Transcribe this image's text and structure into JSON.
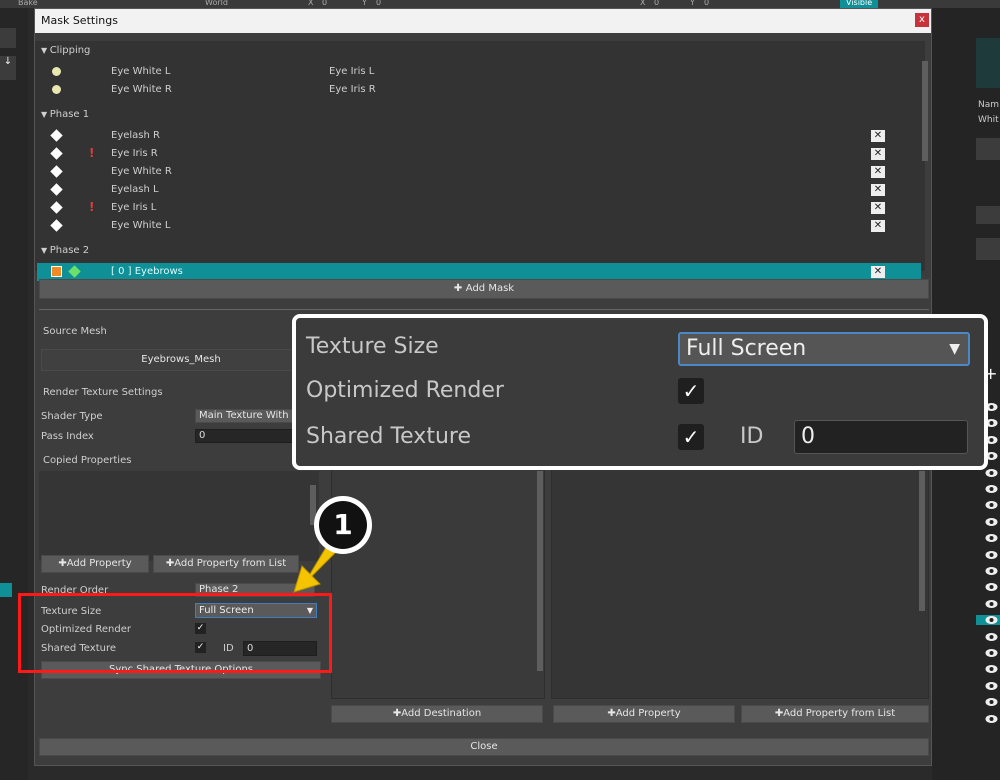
{
  "topbar": {
    "bake": "Bake",
    "world": "World",
    "x1": "X",
    "v1": "0",
    "y1": "Y",
    "v2": "0",
    "x2": "X",
    "v3": "0",
    "y2": "Y",
    "v4": "0",
    "visible": "Visible"
  },
  "right_panel": {
    "name_label": "Nam",
    "name_value": "Whit"
  },
  "dialog": {
    "title": "Mask Settings",
    "close_x": "x",
    "groups": [
      {
        "label": "Clipping",
        "rows": [
          {
            "name": "Eye White L",
            "name2": "Eye Iris L"
          },
          {
            "name": "Eye White R",
            "name2": "Eye Iris R"
          }
        ]
      },
      {
        "label": "Phase 1",
        "rows": [
          {
            "name": "Eyelash R",
            "warn": false
          },
          {
            "name": "Eye Iris R",
            "warn": true
          },
          {
            "name": "Eye White R",
            "warn": false
          },
          {
            "name": "Eyelash L",
            "warn": false
          },
          {
            "name": "Eye Iris L",
            "warn": true
          },
          {
            "name": "Eye White L",
            "warn": false
          }
        ]
      },
      {
        "label": "Phase 2",
        "rows": [
          {
            "name": "[ 0 ] Eyebrows",
            "selected": true
          }
        ]
      }
    ],
    "delete_glyph": "✕",
    "warn_glyph": "!",
    "add_mask": "Add Mask",
    "source_mesh_label": "Source Mesh",
    "source_mesh_value": "Eyebrows_Mesh",
    "render_texture_settings": "Render Texture Settings",
    "shader_type_label": "Shader Type",
    "shader_type_value": "Main Texture With C",
    "pass_index_label": "Pass Index",
    "pass_index_value": "0",
    "copied_properties": "Copied Properties",
    "add_property": "Add Property",
    "add_property_from_list": "Add Property from List",
    "render_order_label": "Render Order",
    "render_order_value": "Phase 2",
    "texture_size_label": "Texture Size",
    "texture_size_value": "Full Screen",
    "optimized_render_label": "Optimized Render",
    "shared_texture_label": "Shared Texture",
    "id_label": "ID",
    "id_value": "0",
    "sync_button": "Sync Shared Texture Options",
    "add_destination": "Add Destination",
    "add_property_right": "Add Property",
    "add_property_from_list_right": "Add Property from List",
    "close": "Close"
  },
  "zoom": {
    "texture_size_label": "Texture Size",
    "texture_size_value": "Full Screen",
    "optimized_render_label": "Optimized Render",
    "shared_texture_label": "Shared Texture",
    "id_label": "ID",
    "id_value": "0"
  },
  "badge": "1",
  "check_glyph": "✓",
  "colors": {
    "highlight": "#0f8f96",
    "red_box": "#ff1a1a",
    "arrow": "#f5c400"
  }
}
